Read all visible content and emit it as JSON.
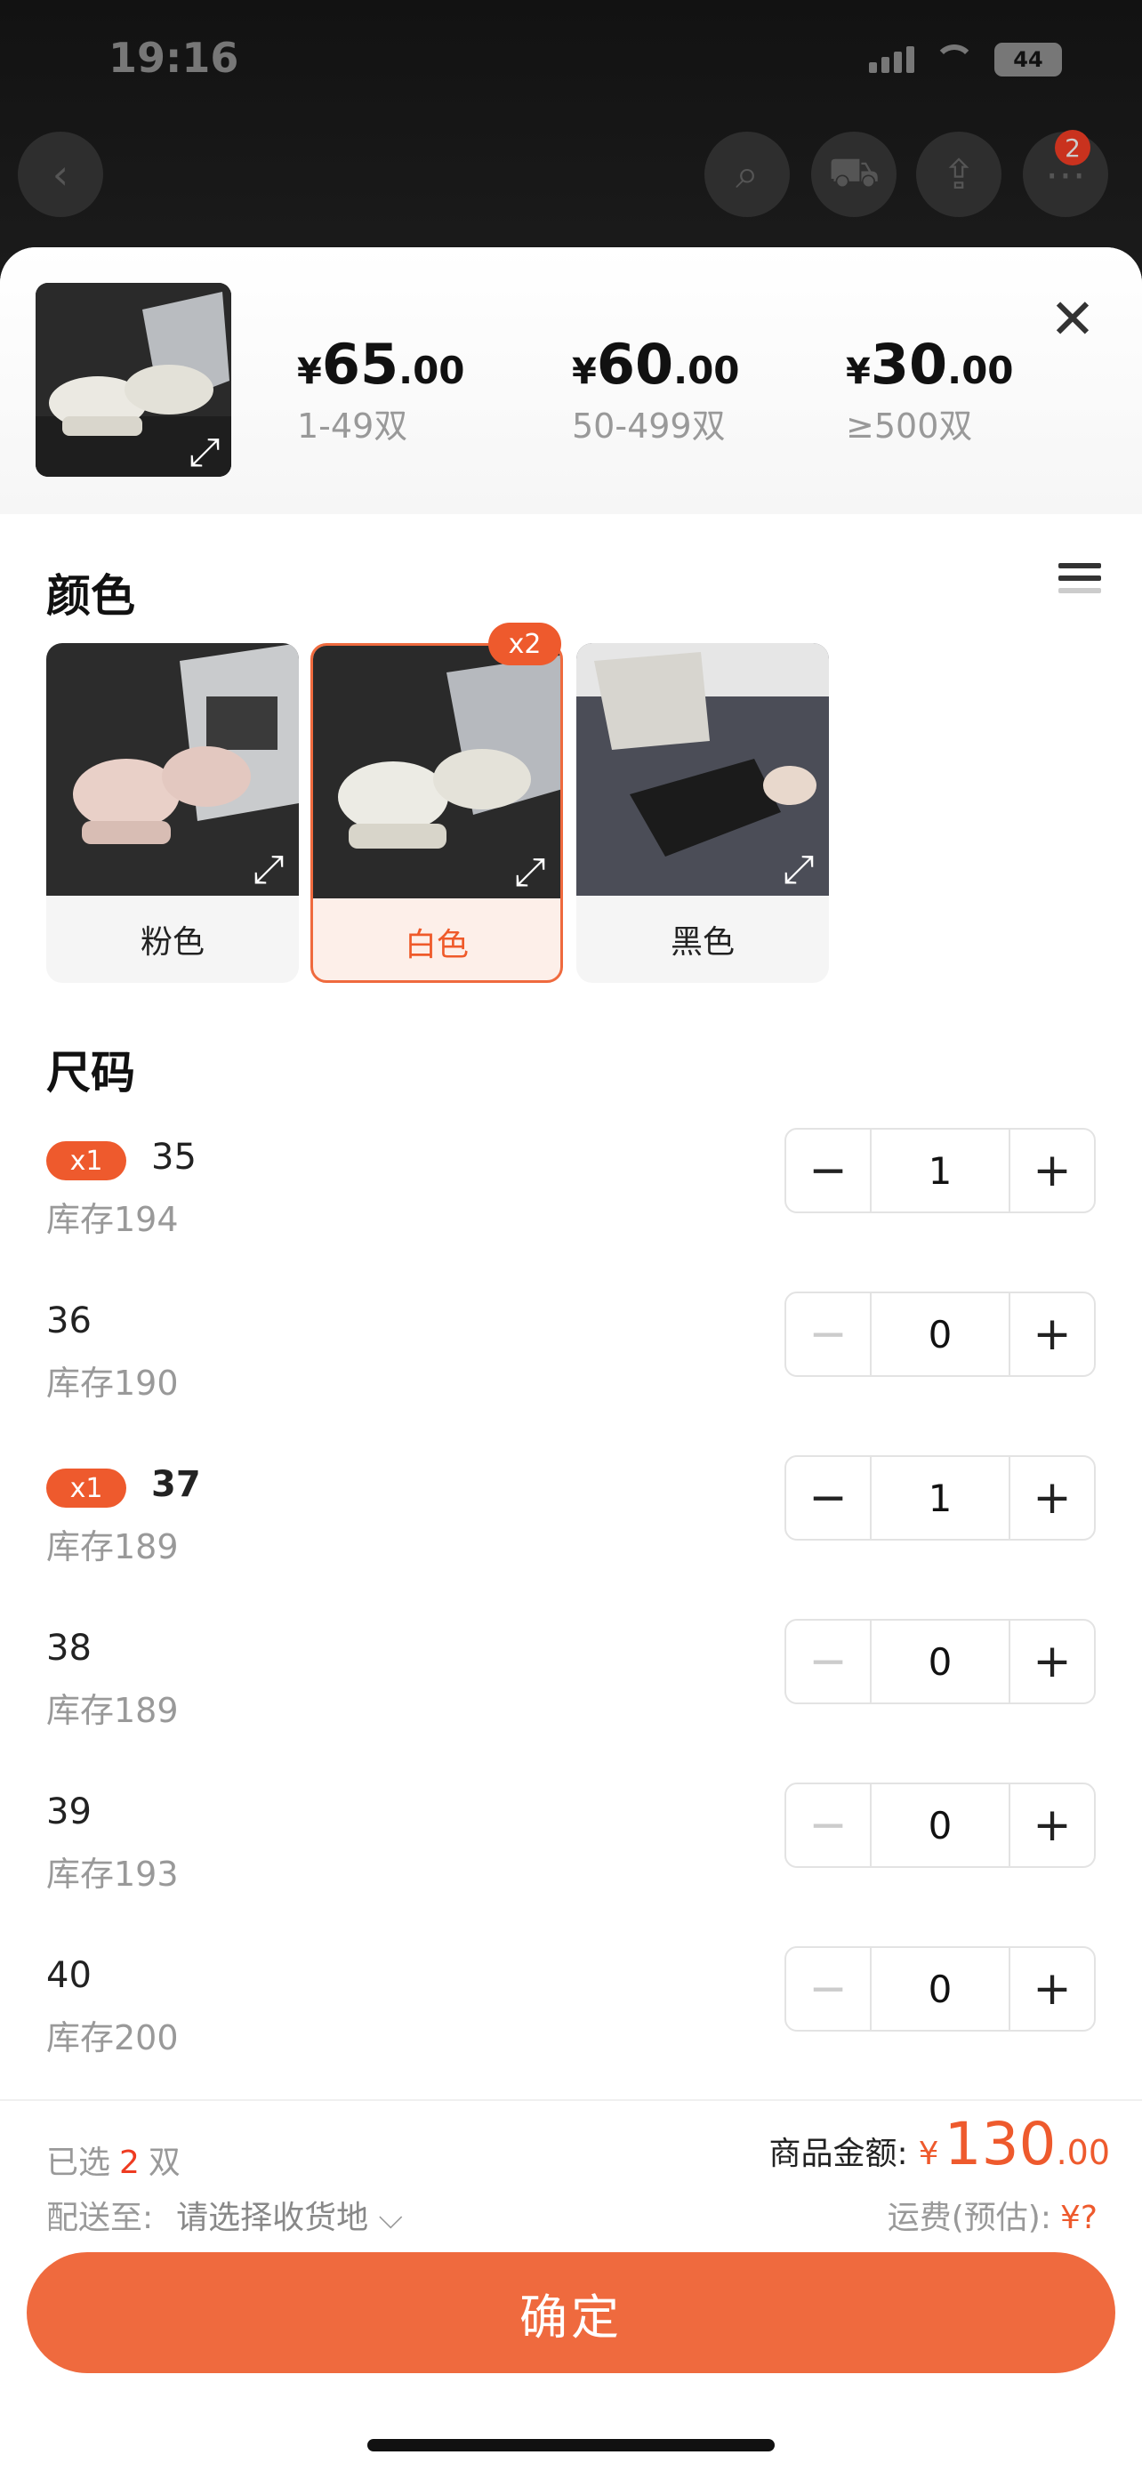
{
  "status": {
    "time": "19:16",
    "battery": "44"
  },
  "header": {
    "cart_badge": "2"
  },
  "product": {
    "tiers": [
      {
        "currency": "¥",
        "int": "65",
        "dec": ".00",
        "qty": "1-49双"
      },
      {
        "currency": "¥",
        "int": "60",
        "dec": ".00",
        "qty": "50-499双"
      },
      {
        "currency": "¥",
        "int": "30",
        "dec": ".00",
        "qty": "≥500双"
      }
    ]
  },
  "color": {
    "title": "颜色",
    "options": [
      {
        "label": "粉色"
      },
      {
        "label": "白色",
        "badge": "x2"
      },
      {
        "label": "黑色"
      }
    ]
  },
  "size": {
    "title": "尺码",
    "rows": [
      {
        "size": "35",
        "stock": "库存194",
        "qty": "1",
        "badge": "x1"
      },
      {
        "size": "36",
        "stock": "库存190",
        "qty": "0"
      },
      {
        "size": "37",
        "stock": "库存189",
        "qty": "1",
        "badge": "x1"
      },
      {
        "size": "38",
        "stock": "库存189",
        "qty": "0"
      },
      {
        "size": "39",
        "stock": "库存193",
        "qty": "0"
      },
      {
        "size": "40",
        "stock": "库存200",
        "qty": "0"
      }
    ]
  },
  "footer": {
    "selected_prefix": "已选",
    "selected_count": "2",
    "selected_unit": "双",
    "ship_label": "配送至:",
    "ship_placeholder": "请选择收货地",
    "amount_label": "商品金额:",
    "amount_currency": "¥",
    "amount_int": "130",
    "amount_dec": ".00",
    "fee_label": "运费(预估):",
    "fee_value": "¥?",
    "confirm_label": "确定"
  },
  "colors": {
    "accent": "#ef6a3e",
    "badge": "#ee5a2d"
  }
}
